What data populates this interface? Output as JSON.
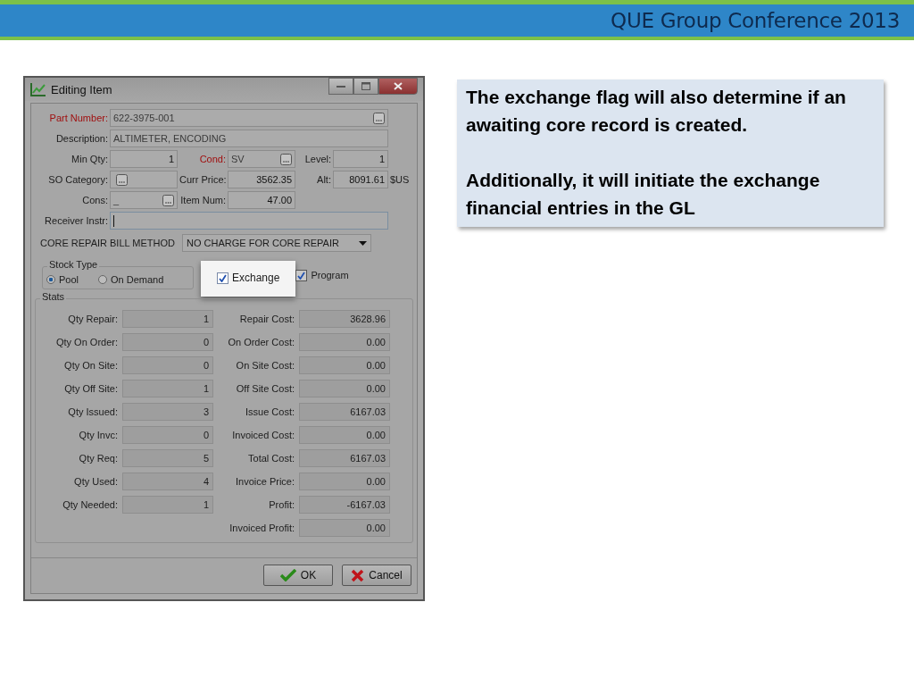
{
  "slide_header": {
    "title": "QUE Group Conference 2013"
  },
  "window": {
    "title": "Editing Item"
  },
  "form_rows": [
    {
      "items": [
        {
          "kind": "label",
          "text": "Part Number:",
          "required": true
        },
        {
          "kind": "text_field",
          "value": "622-3975-001",
          "lookup": true
        }
      ]
    },
    {
      "items": [
        {
          "kind": "label",
          "text": "Description:",
          "required": false
        },
        {
          "kind": "text_field",
          "value": "ALTIMETER, ENCODING",
          "lookup": false
        }
      ]
    },
    {
      "items": [
        {
          "kind": "label",
          "text": "Min Qty:",
          "required": false
        },
        {
          "kind": "number_field",
          "value": "1",
          "lookup": false
        },
        {
          "kind": "label",
          "text": "Cond:",
          "required": true
        },
        {
          "kind": "text_field",
          "value": "SV",
          "lookup": true
        },
        {
          "kind": "label",
          "text": "Level:",
          "required": false
        },
        {
          "kind": "number_field",
          "value": "1",
          "lookup": false
        }
      ]
    },
    {
      "items": [
        {
          "kind": "label",
          "text": "SO Category:",
          "required": false
        },
        {
          "kind": "text_field",
          "lookup": true
        },
        {
          "kind": "label",
          "text": "Curr Price:",
          "required": false
        },
        {
          "kind": "number_field",
          "value": "3562.35",
          "lookup": false
        },
        {
          "kind": "label",
          "text": "Alt:",
          "required": false
        },
        {
          "kind": "number_field",
          "value": "8091.61",
          "lookup": false
        },
        {
          "kind": "unit",
          "text": "$US"
        }
      ]
    },
    {
      "items": [
        {
          "kind": "label",
          "text": "Cons:",
          "required": false
        },
        {
          "kind": "text_field",
          "value": "_",
          "lookup": true
        },
        {
          "kind": "label",
          "text": "Item Num:",
          "required": false
        },
        {
          "kind": "number_field",
          "value": "47.00",
          "lookup": false
        }
      ]
    },
    {
      "items": [
        {
          "kind": "label",
          "text": "Receiver Instr:",
          "required": false
        },
        {
          "kind": "text_field",
          "lookup": false,
          "focused": true
        }
      ]
    }
  ],
  "bill_method": {
    "label": "CORE REPAIR BILL METHOD",
    "value": "NO CHARGE FOR CORE REPAIR"
  },
  "stock_type": {
    "title": "Stock Type",
    "options": [
      {
        "label": "Pool",
        "selected": true
      },
      {
        "label": "On Demand",
        "selected": false
      }
    ]
  },
  "checkboxes": [
    {
      "label": "Exchange",
      "checked": true,
      "highlighted": true
    },
    {
      "label": "Program",
      "checked": true,
      "highlighted": false
    }
  ],
  "stats": {
    "title": "Stats",
    "rows": [
      {
        "left_label": "Qty Repair:",
        "left_value": "1",
        "right_label": "Repair Cost:",
        "right_value": "3628.96"
      },
      {
        "left_label": "Qty On Order:",
        "left_value": "0",
        "right_label": "On Order Cost:",
        "right_value": "0.00"
      },
      {
        "left_label": "Qty On Site:",
        "left_value": "0",
        "right_label": "On Site Cost:",
        "right_value": "0.00"
      },
      {
        "left_label": "Qty Off Site:",
        "left_value": "1",
        "right_label": "Off Site Cost:",
        "right_value": "0.00"
      },
      {
        "left_label": "Qty Issued:",
        "left_value": "3",
        "right_label": "Issue Cost:",
        "right_value": "6167.03"
      },
      {
        "left_label": "Qty Invc:",
        "left_value": "0",
        "right_label": "Invoiced Cost:",
        "right_value": "0.00"
      },
      {
        "left_label": "Qty Req:",
        "left_value": "5",
        "right_label": "Total Cost:",
        "right_value": "6167.03"
      },
      {
        "left_label": "Qty Used:",
        "left_value": "4",
        "right_label": "Invoice Price:",
        "right_value": "0.00"
      },
      {
        "left_label": "Qty Needed:",
        "left_value": "1",
        "right_label": "Profit:",
        "right_value": "-6167.03"
      },
      {
        "right_label": "Invoiced Profit:",
        "right_value": "0.00"
      }
    ]
  },
  "buttons": [
    {
      "kind": "ok",
      "label": "OK"
    },
    {
      "kind": "cancel",
      "label": "Cancel"
    }
  ],
  "callout": {
    "paragraphs": [
      "The exchange flag will also determine if an awaiting core record is created.",
      "Additionally, it will initiate the exchange financial entries in the GL"
    ]
  }
}
